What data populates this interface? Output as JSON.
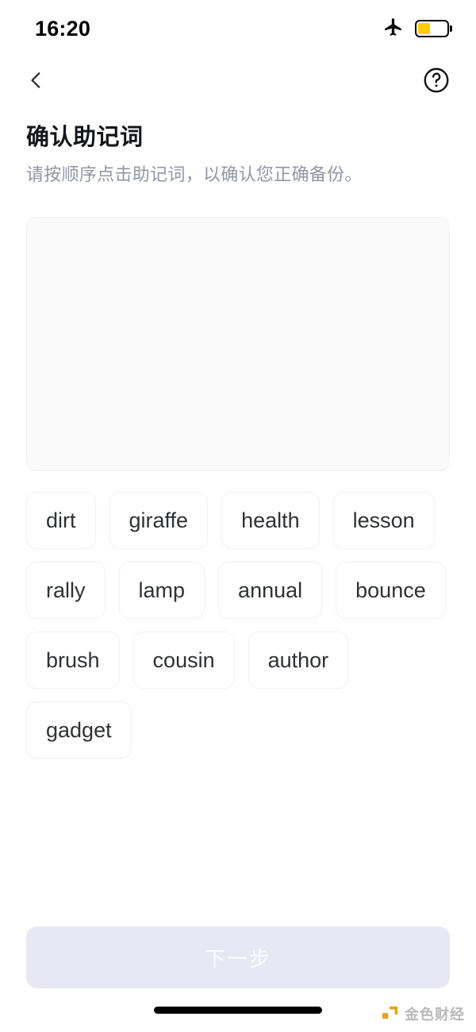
{
  "status_bar": {
    "time": "16:20",
    "airplane_icon": "airplane-mode-icon",
    "battery_icon": "battery-low-power-icon",
    "battery_level_percent": 42,
    "battery_fill_color": "#ffcc00"
  },
  "nav_bar": {
    "back_icon": "chevron-left-icon",
    "help_icon": "question-mark-circle-icon"
  },
  "header": {
    "title": "确认助记词",
    "subtitle": "请按顺序点击助记词，以确认您正确备份。"
  },
  "answer_area": {
    "selected_words": [],
    "background_color": "#fafafa",
    "border_color": "#f0f0f0"
  },
  "word_pool": {
    "words": [
      "dirt",
      "giraffe",
      "health",
      "lesson",
      "rally",
      "lamp",
      "annual",
      "bounce",
      "brush",
      "cousin",
      "author",
      "gadget"
    ]
  },
  "footer": {
    "next_label": "下一步",
    "next_enabled": false,
    "next_bg_color": "#e8e8f4",
    "next_text_color": "#fbfbfe"
  },
  "watermark": {
    "text": "金色财经",
    "logo_color": "#e8a317"
  }
}
